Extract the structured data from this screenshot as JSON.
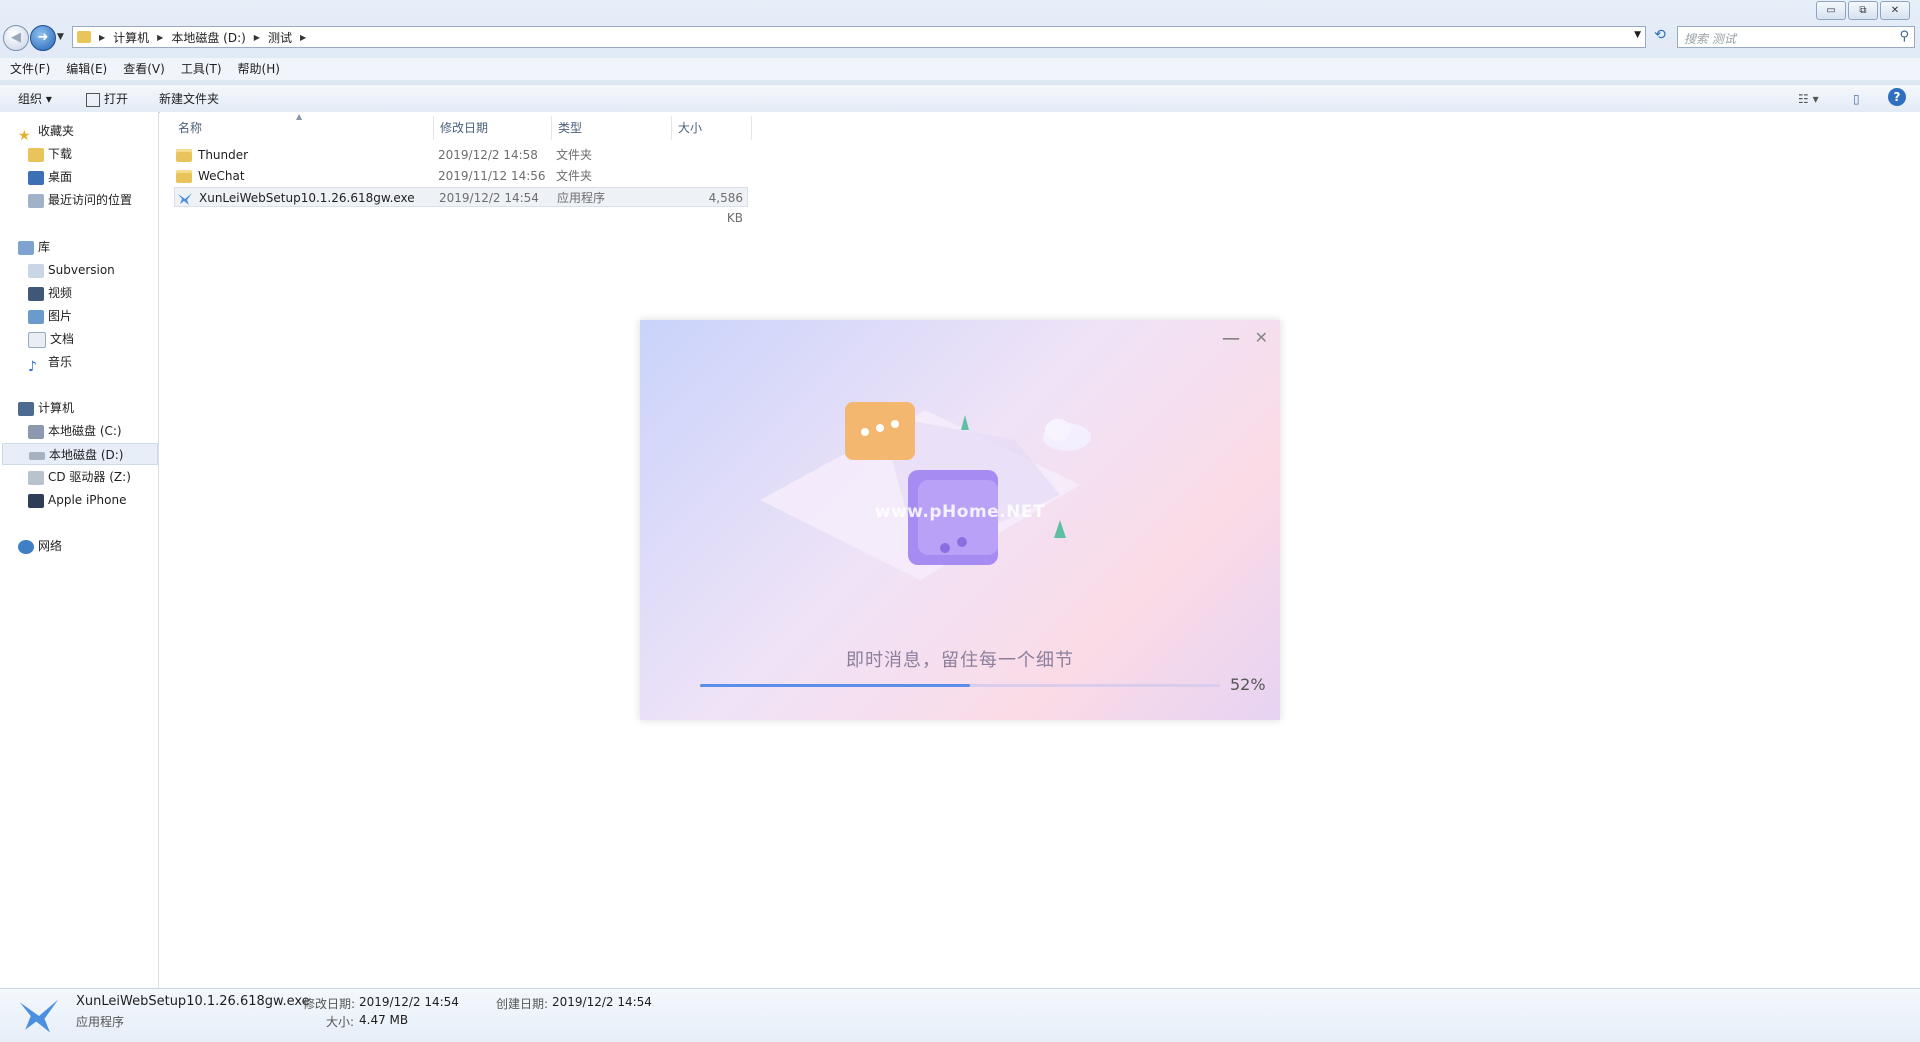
{
  "window": {
    "minimize_glyph": "▭",
    "maximize_glyph": "⧉",
    "close_glyph": "✕"
  },
  "address": {
    "crumbs": [
      "计算机",
      "本地磁盘 (D:)",
      "测试"
    ],
    "search_placeholder": "搜索 测试"
  },
  "menu": [
    "文件(F)",
    "编辑(E)",
    "查看(V)",
    "工具(T)",
    "帮助(H)"
  ],
  "toolbar": {
    "organize": "组织 ▾",
    "open": "打开",
    "new_folder": "新建文件夹"
  },
  "sidebar": {
    "favorites": "收藏夹",
    "favorites_items": [
      "下载",
      "桌面",
      "最近访问的位置"
    ],
    "libraries": "库",
    "library_items": [
      "Subversion",
      "视频",
      "图片",
      "文档",
      "音乐"
    ],
    "computer": "计算机",
    "computer_items": [
      "本地磁盘 (C:)",
      "本地磁盘 (D:)",
      "CD 驱动器 (Z:)",
      "Apple iPhone"
    ],
    "network": "网络"
  },
  "columns": [
    "名称",
    "修改日期",
    "类型",
    "大小"
  ],
  "files": [
    {
      "name": "Thunder",
      "date": "2019/12/2 14:58",
      "type": "文件夹",
      "size": ""
    },
    {
      "name": "WeChat",
      "date": "2019/11/12 14:56",
      "type": "文件夹",
      "size": ""
    },
    {
      "name": "XunLeiWebSetup10.1.26.618gw.exe",
      "date": "2019/12/2 14:54",
      "type": "应用程序",
      "size": "4,586 KB"
    }
  ],
  "installer": {
    "watermark": "www.pHome.NET",
    "slogan": "即时消息，留住每一个细节",
    "progress_percent": 52,
    "progress_label": "52%",
    "accent": "#5b8ee8"
  },
  "status": {
    "filename": "XunLeiWebSetup10.1.26.618gw.exe",
    "type": "应用程序",
    "modified_label": "修改日期:",
    "modified": "2019/12/2 14:54",
    "size_label": "大小:",
    "size": "4.47 MB",
    "created_label": "创建日期:",
    "created": "2019/12/2 14:54"
  }
}
